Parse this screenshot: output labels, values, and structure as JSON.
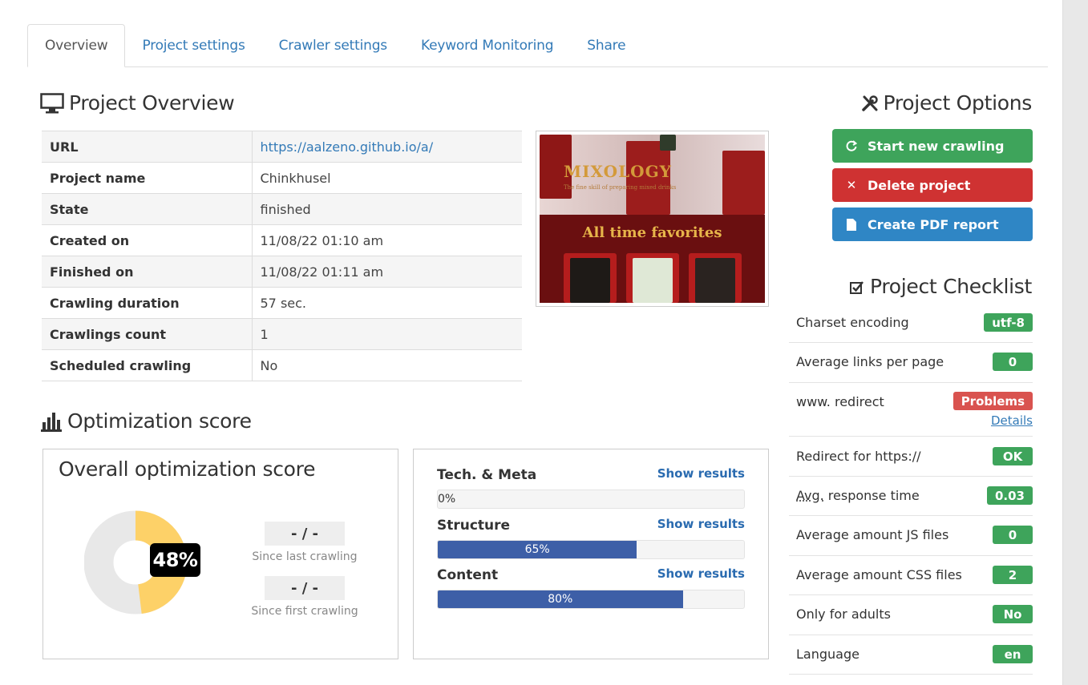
{
  "tabs": [
    "Overview",
    "Project settings",
    "Crawler settings",
    "Keyword Monitoring",
    "Share"
  ],
  "overview": {
    "title": "Project Overview",
    "rows": [
      {
        "key": "URL",
        "value": "https://aalzeno.github.io/a/"
      },
      {
        "key": "Project name",
        "value": "Chinkhusel"
      },
      {
        "key": "State",
        "value": "finished"
      },
      {
        "key": "Created on",
        "value": "11/08/22 01:10 am"
      },
      {
        "key": "Finished on",
        "value": "11/08/22 01:11 am"
      },
      {
        "key": "Crawling duration",
        "value": "57 sec."
      },
      {
        "key": "Crawlings count",
        "value": "1"
      },
      {
        "key": "Scheduled crawling",
        "value": "No"
      }
    ]
  },
  "thumbnail": {
    "brand": "MIXOLOGY",
    "tagline": "The fine skill of preparing mixed drinks",
    "headline": "All time favorites"
  },
  "options": {
    "title": "Project Options",
    "start": "Start new crawling",
    "delete": "Delete project",
    "pdf": "Create PDF report"
  },
  "checklist": {
    "title": "Project Checklist",
    "details_label": "Details",
    "items": [
      {
        "label": "Charset encoding",
        "badge": "utf-8",
        "status": "ok"
      },
      {
        "label": "Average links per page",
        "badge": "0",
        "status": "ok"
      },
      {
        "label": "www. redirect",
        "badge": "Problems",
        "status": "problem"
      },
      {
        "label": "Redirect for https://",
        "badge": "OK",
        "status": "ok"
      },
      {
        "label_abbr": "Avg.",
        "label_rest": " response time",
        "badge": "0.03",
        "status": "ok"
      },
      {
        "label": "Average amount JS files",
        "badge": "0",
        "status": "ok"
      },
      {
        "label": "Average amount CSS files",
        "badge": "2",
        "status": "ok"
      },
      {
        "label": "Only for adults",
        "badge": "No",
        "status": "ok"
      },
      {
        "label": "Language",
        "badge": "en",
        "status": "ok"
      }
    ]
  },
  "optimization": {
    "title": "Optimization score",
    "overall_title": "Overall optimization score",
    "score_label": "48%",
    "score": 48,
    "since_last_value": "- / -",
    "since_last_label": "Since last crawling",
    "since_first_value": "- / -",
    "since_first_label": "Since first crawling",
    "show_results": "Show results",
    "bars": [
      {
        "label": "Tech. & Meta",
        "value": 0,
        "text": "0%"
      },
      {
        "label": "Structure",
        "value": 65,
        "text": "65%"
      },
      {
        "label": "Content",
        "value": 80,
        "text": "80%"
      }
    ]
  },
  "colors": {
    "link": "#337ab7",
    "green": "#3ea45b",
    "red": "#cf3232",
    "blue": "#2f86c5",
    "bar": "#3d5fa7",
    "donut_fill": "#fdd168",
    "donut_track": "#e8e8e8"
  }
}
